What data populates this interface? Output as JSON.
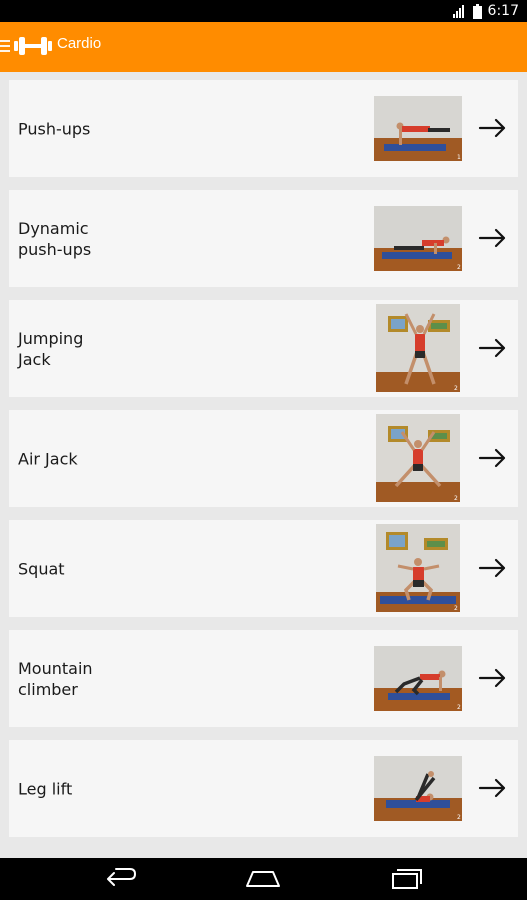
{
  "status_bar": {
    "time": "6:17"
  },
  "header": {
    "title": "Cardio",
    "icon": "dumbbell-icon"
  },
  "exercises": [
    {
      "label": "Push-ups",
      "badge": "1"
    },
    {
      "label": "Dynamic\npush-ups",
      "badge": "2"
    },
    {
      "label": "Jumping\nJack",
      "badge": "2"
    },
    {
      "label": "Air Jack",
      "badge": "2"
    },
    {
      "label": "Squat",
      "badge": "2"
    },
    {
      "label": "Mountain\nclimber",
      "badge": "2"
    },
    {
      "label": "Leg lift",
      "badge": "2"
    }
  ],
  "colors": {
    "accent": "#ff8c00",
    "card": "#f6f6f6",
    "background": "#e8e8e8"
  },
  "nav": {
    "back_icon": "back-icon",
    "home_icon": "home-icon",
    "recents_icon": "recents-icon"
  }
}
